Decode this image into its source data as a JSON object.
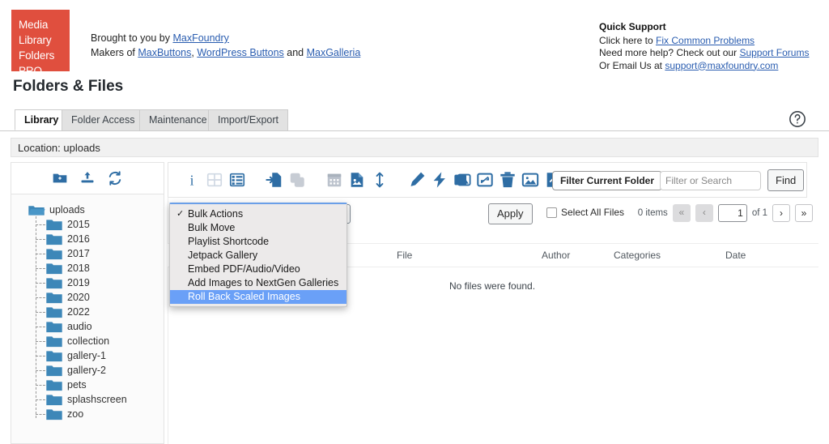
{
  "header": {
    "logo_lines": [
      "Media",
      "Library",
      "Folders PRO"
    ],
    "logo_color": "#e04f3e",
    "brought_prefix": "Brought to you by ",
    "brought_link": "MaxFoundry",
    "makers_prefix": "Makers of ",
    "makers_link1": "MaxButtons",
    "makers_sep1": ", ",
    "makers_link2": "WordPress Buttons",
    "makers_sep2": " and ",
    "makers_link3": "MaxGalleria",
    "support_title": "Quick Support",
    "support_line1_prefix": "Click here to ",
    "support_line1_link": "Fix Common Problems",
    "support_line2_prefix": "Need more help? Check out our ",
    "support_line2_link": "Support Forums",
    "support_line3_prefix": "Or Email Us at ",
    "support_line3_link": "support@maxfoundry.com"
  },
  "page_title": "Folders & Files",
  "tabs": [
    {
      "label": "Library",
      "active": true
    },
    {
      "label": "Folder Access",
      "active": false
    },
    {
      "label": "Maintenance",
      "active": false
    },
    {
      "label": "Import/Export",
      "active": false
    }
  ],
  "help_icon": "question-mark-circle-icon",
  "location": {
    "label": "Location: uploads"
  },
  "left_toolbar": {
    "icons": [
      {
        "name": "add-folder-icon",
        "title": "Add Folder"
      },
      {
        "name": "upload-icon",
        "title": "Upload"
      },
      {
        "name": "refresh-icon",
        "title": "Refresh"
      }
    ]
  },
  "tree": {
    "root": {
      "label": "uploads"
    },
    "children": [
      {
        "label": "2015"
      },
      {
        "label": "2016"
      },
      {
        "label": "2017"
      },
      {
        "label": "2018"
      },
      {
        "label": "2019"
      },
      {
        "label": "2020"
      },
      {
        "label": "2022"
      },
      {
        "label": "audio"
      },
      {
        "label": "collection"
      },
      {
        "label": "gallery-1"
      },
      {
        "label": "gallery-2"
      },
      {
        "label": "pets"
      },
      {
        "label": "splashscreen"
      },
      {
        "label": "zoo"
      }
    ]
  },
  "toolbar": {
    "icons": [
      {
        "name": "info-icon",
        "state": "active"
      },
      {
        "name": "grid-view-icon",
        "state": "disabled"
      },
      {
        "name": "list-view-icon",
        "state": "active"
      },
      {
        "name": "import-file-icon",
        "state": "active"
      },
      {
        "name": "duplicate-icon",
        "state": "disabled"
      },
      {
        "name": "calendar-icon",
        "state": "disabled"
      },
      {
        "name": "file-image-icon",
        "state": "active"
      },
      {
        "name": "sort-vertical-icon",
        "state": "active"
      },
      {
        "name": "edit-pencil-icon",
        "state": "active"
      },
      {
        "name": "lightning-bolt-icon",
        "state": "active"
      },
      {
        "name": "images-stack-icon",
        "state": "active"
      },
      {
        "name": "resize-image-icon",
        "state": "active"
      },
      {
        "name": "trash-icon",
        "state": "active"
      },
      {
        "name": "image-icon",
        "state": "active"
      },
      {
        "name": "file-upload-icon",
        "state": "active"
      },
      {
        "name": "sitemap-icon",
        "state": "active"
      }
    ],
    "filter_current_folder": "Filter Current Folder",
    "search_placeholder": "Filter or Search",
    "search_value": "",
    "clear_icon": "clear-circle-icon",
    "find_label": "Find"
  },
  "bulk": {
    "select_value": "Bulk Actions",
    "apply_label": "Apply",
    "select_all_label": "Select All Files",
    "select_all_checked": false
  },
  "dropdown": {
    "open": true,
    "check_glyph": "✓",
    "items": [
      {
        "label": "Bulk Actions",
        "checked": true,
        "selected": false
      },
      {
        "label": "Bulk Move",
        "checked": false,
        "selected": false
      },
      {
        "label": "Playlist Shortcode",
        "checked": false,
        "selected": false
      },
      {
        "label": "Jetpack Gallery",
        "checked": false,
        "selected": false
      },
      {
        "label": "Embed PDF/Audio/Video",
        "checked": false,
        "selected": false
      },
      {
        "label": "Add Images to NextGen Galleries",
        "checked": false,
        "selected": false
      },
      {
        "label": "Roll Back Scaled Images",
        "checked": false,
        "selected": true
      }
    ],
    "highlight_color": "#6aa0f7"
  },
  "pager": {
    "items_label": "0 items",
    "first_label": "«",
    "prev_label": "‹",
    "current_page": "1",
    "of_label": "of 1",
    "next_label": "›",
    "last_label": "»"
  },
  "table": {
    "columns": [
      "File",
      "Author",
      "Categories",
      "Date"
    ],
    "empty_message": "No files were found.",
    "rows": []
  }
}
